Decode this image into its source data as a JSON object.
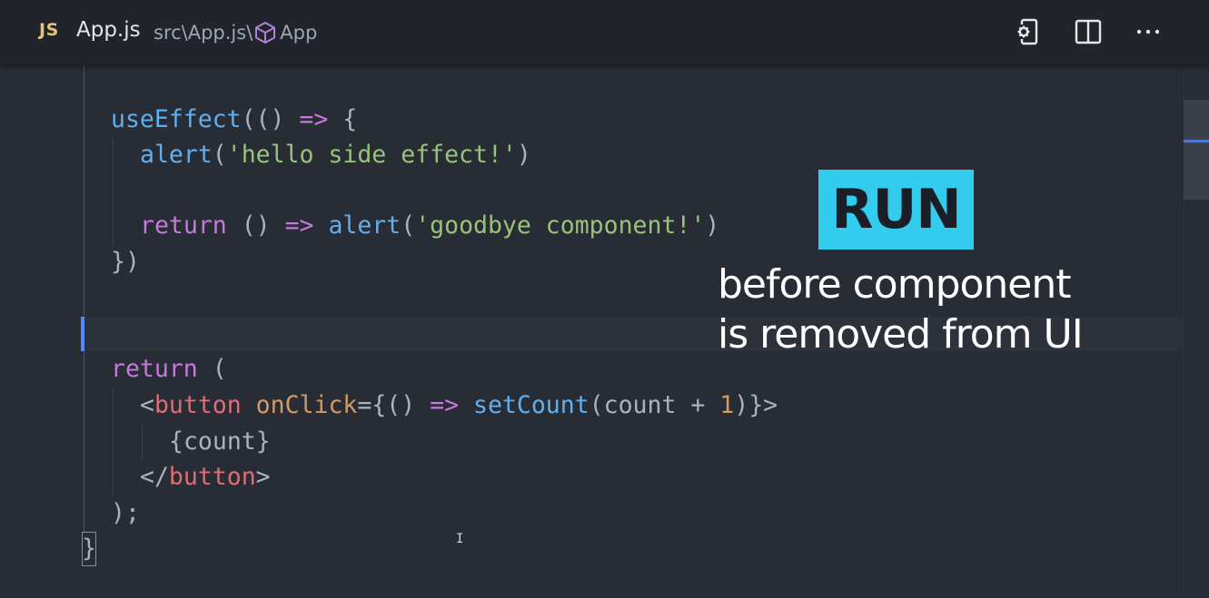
{
  "tab": {
    "language_badge": "JS",
    "file_name": "App.js",
    "breadcrumb": {
      "path": "src\\App.js\\",
      "symbol": "App",
      "symbol_icon": "cube-icon"
    },
    "actions": [
      {
        "icon": "settings-device-icon"
      },
      {
        "icon": "split-editor-icon"
      },
      {
        "icon": "more-actions-icon",
        "glyph": "···"
      }
    ]
  },
  "code": {
    "lines": [
      {
        "tokens": [
          {
            "text": "useEffect",
            "kind": "fn"
          },
          {
            "text": "(() ",
            "kind": "punc"
          },
          {
            "text": "=>",
            "kind": "kw"
          },
          {
            "text": " {",
            "kind": "punc"
          }
        ]
      },
      {
        "tokens": [
          {
            "text": "alert",
            "kind": "fn"
          },
          {
            "text": "(",
            "kind": "punc"
          },
          {
            "text": "'hello side effect!'",
            "kind": "str"
          },
          {
            "text": ")",
            "kind": "punc"
          }
        ]
      },
      {
        "tokens": [
          {
            "text": "return",
            "kind": "kw"
          },
          {
            "text": " () ",
            "kind": "punc"
          },
          {
            "text": "=>",
            "kind": "kw"
          },
          {
            "text": " ",
            "kind": "punc"
          },
          {
            "text": "alert",
            "kind": "fn"
          },
          {
            "text": "(",
            "kind": "punc"
          },
          {
            "text": "'goodbye component!'",
            "kind": "str"
          },
          {
            "text": ")",
            "kind": "punc"
          }
        ]
      },
      {
        "tokens": [
          {
            "text": "})",
            "kind": "punc"
          }
        ]
      },
      {
        "tokens": [
          {
            "text": "return",
            "kind": "kw"
          },
          {
            "text": " (",
            "kind": "punc"
          }
        ]
      },
      {
        "tokens": [
          {
            "text": "<",
            "kind": "punc"
          },
          {
            "text": "button",
            "kind": "tag"
          },
          {
            "text": " ",
            "kind": "punc"
          },
          {
            "text": "onClick",
            "kind": "attr"
          },
          {
            "text": "={() ",
            "kind": "punc"
          },
          {
            "text": "=>",
            "kind": "kw"
          },
          {
            "text": " ",
            "kind": "punc"
          },
          {
            "text": "setCount",
            "kind": "fn"
          },
          {
            "text": "(count + ",
            "kind": "punc"
          },
          {
            "text": "1",
            "kind": "num"
          },
          {
            "text": ")}>",
            "kind": "punc"
          }
        ]
      },
      {
        "tokens": [
          {
            "text": "{count}",
            "kind": "punc"
          }
        ]
      },
      {
        "tokens": [
          {
            "text": "</",
            "kind": "punc"
          },
          {
            "text": "button",
            "kind": "tag"
          },
          {
            "text": ">",
            "kind": "punc"
          }
        ]
      },
      {
        "tokens": [
          {
            "text": ");",
            "kind": "punc"
          }
        ]
      },
      {
        "tokens": [
          {
            "text": "}",
            "kind": "punc"
          }
        ]
      }
    ]
  },
  "overlay": {
    "badge": "RUN",
    "caption_line1": "before component",
    "caption_line2": "is removed from UI"
  },
  "colors": {
    "editor_bg": "#282c34",
    "tabbar_bg": "#21252b",
    "keyword": "#c678dd",
    "function": "#61afef",
    "string": "#98c379",
    "tag": "#e06c75",
    "attribute": "#d19a66",
    "accent_badge": "#33ccee",
    "cursor": "#528bff"
  }
}
